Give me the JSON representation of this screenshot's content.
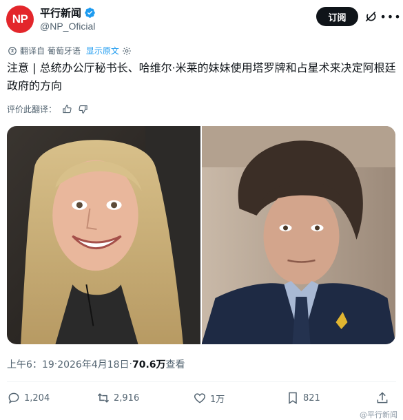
{
  "header": {
    "avatar_text": "NP",
    "display_name": "平行新闻",
    "handle": "@NP_Oficial",
    "subscribe_label": "订阅"
  },
  "translation": {
    "translated_from": "翻译自 葡萄牙语",
    "show_original": "显示原文"
  },
  "tweet": {
    "text": "注意 | 总统办公厅秘书长、哈维尔·米莱的妹妹使用塔罗牌和占星术来决定阿根廷政府的方向",
    "rate_translation": "评价此翻译："
  },
  "meta": {
    "time": "上午6：19",
    "separator": " · ",
    "date": "2026年4月18日",
    "views_count": "70.6万",
    "views_label": " 查看"
  },
  "actions": {
    "replies": "1,204",
    "reposts": "2,916",
    "likes": "1万",
    "bookmarks": "821"
  },
  "watermark": "@平行新闻",
  "colors": {
    "brand_red": "#e3262b",
    "verified_blue": "#1d9bf0",
    "text_primary": "#0f1419",
    "text_secondary": "#536471"
  }
}
